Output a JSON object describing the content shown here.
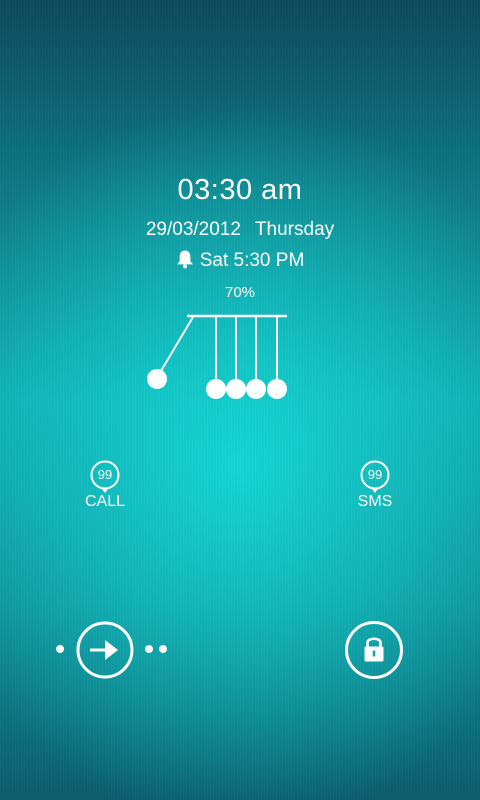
{
  "clock": {
    "time": "03:30 am",
    "date": "29/03/2012",
    "weekday": "Thursday"
  },
  "alarm": {
    "icon": "bell-icon",
    "text": "Sat 5:30 PM"
  },
  "battery": {
    "level_text": "70%",
    "level": 0.7
  },
  "shortcuts": {
    "call": {
      "count": "99",
      "label": "CALL",
      "icon": "call-badge-icon"
    },
    "sms": {
      "count": "99",
      "label": "SMS",
      "icon": "sms-badge-icon"
    }
  },
  "controls": {
    "unlock_icon": "arrow-right-icon",
    "lock_icon": "lock-icon"
  },
  "colors": {
    "background_top": "#0d4a5c",
    "background_center": "#14d6d3",
    "foreground": "#ffffff"
  }
}
